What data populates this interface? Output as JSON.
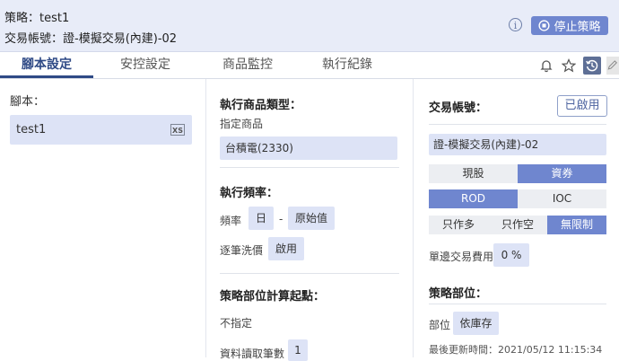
{
  "header": {
    "strategy_label": "策略：",
    "strategy_name": "test1",
    "account_label": "交易帳號：",
    "account_name": "證-模擬交易(內建)-02",
    "stop_button": "停止策略"
  },
  "tabs": [
    {
      "label": "腳本設定",
      "active": true
    },
    {
      "label": "安控設定",
      "active": false
    },
    {
      "label": "商品監控",
      "active": false
    },
    {
      "label": "執行紀錄",
      "active": false
    }
  ],
  "toolbar_icons": [
    "bell-icon",
    "star-icon",
    "history-icon",
    "edit-icon"
  ],
  "script_panel": {
    "title": "腳本：",
    "items": [
      {
        "name": "test1",
        "icon": "xs-icon",
        "icon_text": "XS"
      }
    ]
  },
  "product_panel": {
    "type_title": "執行商品類型：",
    "type_value": "指定商品",
    "product": "台積電(2330)",
    "freq_title": "執行頻率：",
    "freq_label": "頻率",
    "freq_unit": "日",
    "freq_dash": "-",
    "freq_source": "原始值",
    "wash_label": "逐筆洗價",
    "wash_value": "啟用",
    "position_title": "策略部位計算起點：",
    "position_value": "不指定",
    "read_label": "資料讀取筆數",
    "read_value": "1"
  },
  "account_panel": {
    "title": "交易帳號：",
    "enabled_button": "已啟用",
    "account": "證-模擬交易(內建)-02",
    "market_options": [
      {
        "label": "現股",
        "on": false
      },
      {
        "label": "資券",
        "on": true
      }
    ],
    "order_options": [
      {
        "label": "ROD",
        "on": true
      },
      {
        "label": "IOC",
        "on": false
      }
    ],
    "direction_options": [
      {
        "label": "只作多",
        "on": false
      },
      {
        "label": "只作空",
        "on": false
      },
      {
        "label": "無限制",
        "on": true
      }
    ],
    "fee_label": "單邊交易費用",
    "fee_value": "0 %",
    "position_title": "策略部位：",
    "position_label": "部位",
    "position_value": "依庫存",
    "updated": "最後更新時間：2021/05/12 11:15:34"
  },
  "colors": {
    "accent": "#6f86cf",
    "header_bg": "#e8ecf8",
    "chip_bg": "#dde3f6",
    "tab_active": "#2f4a86"
  }
}
